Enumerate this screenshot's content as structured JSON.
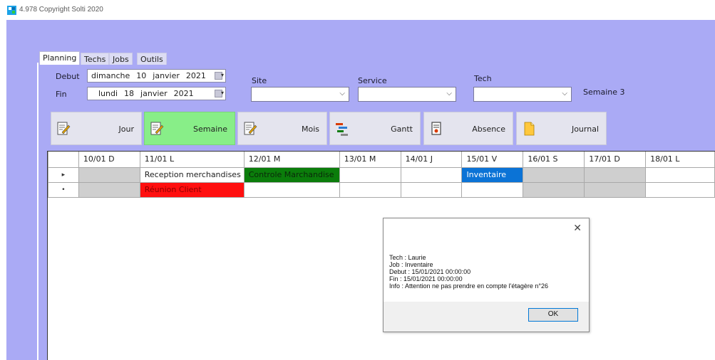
{
  "window": {
    "title": "4.978 Copyright Solti 2020",
    "icon": "app-logo-icon"
  },
  "tabs": [
    {
      "label": "Planning",
      "active": true
    },
    {
      "label": "Techs",
      "active": false
    },
    {
      "label": "Jobs",
      "active": false
    },
    {
      "label": "Outils",
      "active": false
    }
  ],
  "filters": {
    "debut_label": "Debut",
    "fin_label": "Fin",
    "debut": {
      "weekday": "dimanche",
      "day": "10",
      "month": "janvier",
      "year": "2021"
    },
    "fin": {
      "weekday": "lundi",
      "day": "18",
      "month": "janvier",
      "year": "2021"
    },
    "site_label": "Site",
    "site_value": "",
    "service_label": "Service",
    "service_value": "",
    "tech_label": "Tech",
    "tech_value": "",
    "semaine": "Semaine 3"
  },
  "view_buttons": [
    {
      "label": "Jour",
      "icon": "edit-note-icon",
      "selected": false
    },
    {
      "label": "Semaine",
      "icon": "edit-note-icon",
      "selected": true
    },
    {
      "label": "Mois",
      "icon": "edit-note-icon",
      "selected": false
    },
    {
      "label": "Gantt",
      "icon": "gantt-chart-icon",
      "selected": false
    },
    {
      "label": "Absence",
      "icon": "document-badge-icon",
      "selected": false
    },
    {
      "label": "Journal",
      "icon": "notepad-icon",
      "selected": false
    }
  ],
  "grid": {
    "columns": [
      "10/01 D",
      "11/01 L",
      "12/01 M",
      "13/01 M",
      "14/01 J",
      "15/01 V",
      "16/01 S",
      "17/01 D",
      "18/01 L"
    ],
    "rows": [
      {
        "marker": "▸",
        "cells": [
          {
            "text": "",
            "color": "gray"
          },
          {
            "text": "Reception merchandises",
            "color": "white"
          },
          {
            "text": "Controle Marchandise",
            "color": "green"
          },
          {
            "text": "",
            "color": "white"
          },
          {
            "text": "",
            "color": "white"
          },
          {
            "text": "Inventaire",
            "color": "blue"
          },
          {
            "text": "",
            "color": "gray"
          },
          {
            "text": "",
            "color": "gray"
          },
          {
            "text": "",
            "color": "white"
          }
        ]
      },
      {
        "marker": "•",
        "cells": [
          {
            "text": "",
            "color": "gray"
          },
          {
            "text": "Réunion Client",
            "color": "red"
          },
          {
            "text": "",
            "color": "white"
          },
          {
            "text": "",
            "color": "white"
          },
          {
            "text": "",
            "color": "white"
          },
          {
            "text": "",
            "color": "white"
          },
          {
            "text": "",
            "color": "gray"
          },
          {
            "text": "",
            "color": "gray"
          },
          {
            "text": "",
            "color": "white"
          }
        ]
      }
    ]
  },
  "dialog": {
    "lines": [
      "Tech : Laurie",
      "Job : Inventaire",
      "Debut : 15/01/2021 00:00:00",
      "Fin : 15/01/2021 00:00:00",
      "Info : Attention ne pas prendre en compte l'étagère n°26"
    ],
    "ok_label": "OK",
    "close_glyph": "✕"
  },
  "colors": {
    "background": "#aaaaf5",
    "selected_button": "#88ee88",
    "green": "#0b7d0b",
    "red": "#ff0f0f",
    "blue": "#0b73d6",
    "gray": "#cfcfcf"
  }
}
